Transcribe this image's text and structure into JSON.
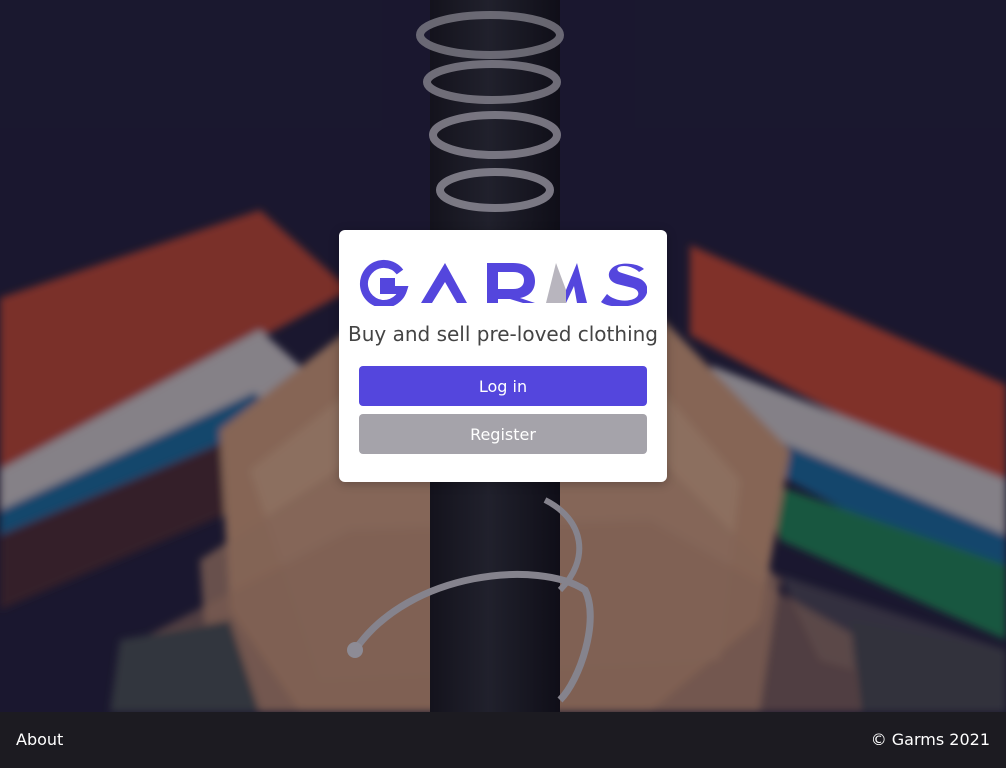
{
  "background": {
    "image_alt": "Clothes hanging on a rail"
  },
  "brand": {
    "logo_text": "GARMS",
    "primary_color": "#5446dd",
    "secondary_color": "#a5a3aa"
  },
  "card": {
    "tagline": "Buy and sell pre-loved clothing",
    "login_label": "Log in",
    "register_label": "Register"
  },
  "footer": {
    "about_label": "About",
    "copyright": "© Garms 2021"
  }
}
